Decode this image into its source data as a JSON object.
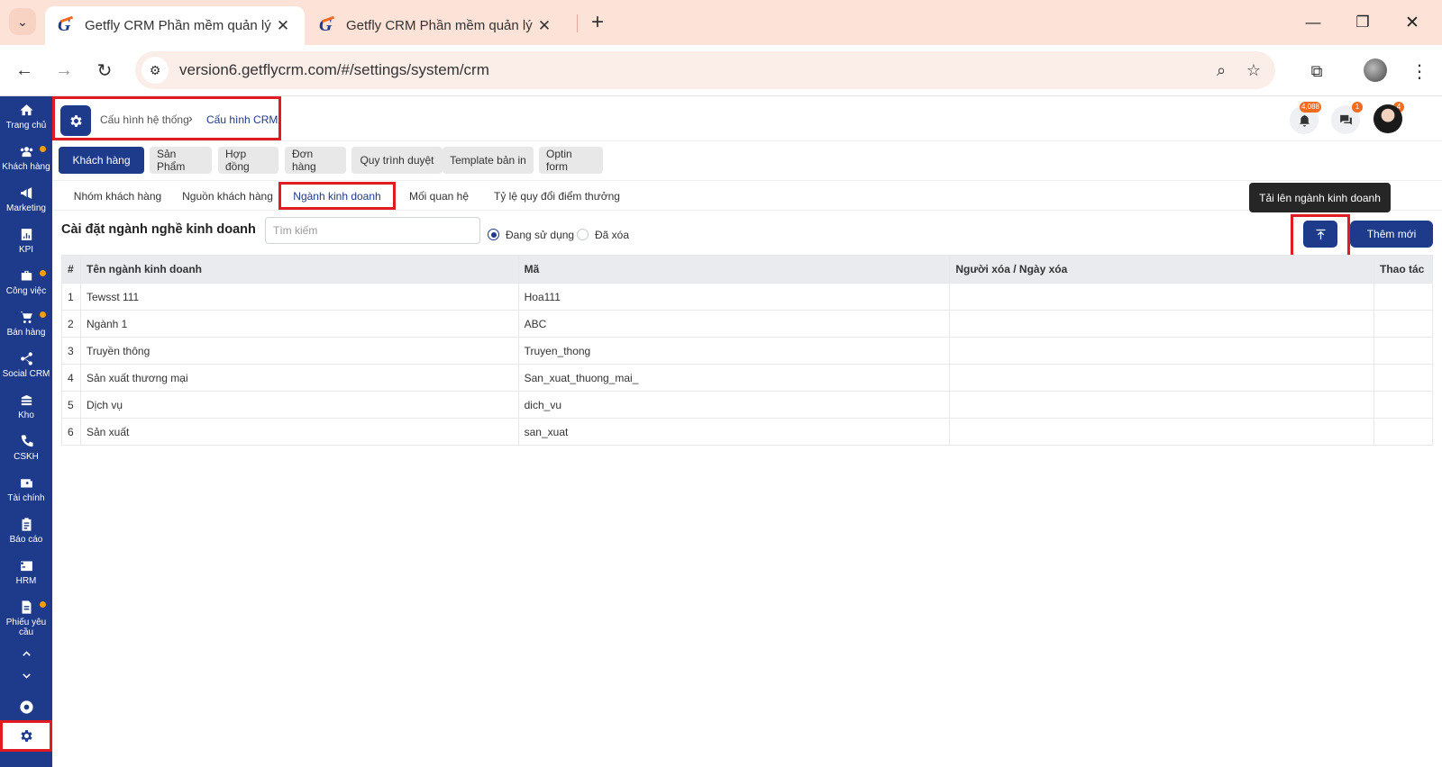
{
  "browser": {
    "tabs": [
      {
        "title": "Getfly CRM Phần mềm quản lý"
      },
      {
        "title": "Getfly CRM Phần mềm quản lý"
      }
    ],
    "url": "version6.getflycrm.com/#/settings/system/crm"
  },
  "sidebar": {
    "items": [
      {
        "label": "Trang chủ",
        "icon": "home-icon"
      },
      {
        "label": "Khách hàng",
        "icon": "users-icon"
      },
      {
        "label": "Marketing",
        "icon": "megaphone-icon"
      },
      {
        "label": "KPI",
        "icon": "chart-icon"
      },
      {
        "label": "Công việc",
        "icon": "briefcase-icon"
      },
      {
        "label": "Bán hàng",
        "icon": "cart-icon"
      },
      {
        "label": "Social CRM",
        "icon": "share-icon"
      },
      {
        "label": "Kho",
        "icon": "warehouse-icon"
      },
      {
        "label": "CSKH",
        "icon": "phone-icon"
      },
      {
        "label": "Tài chính",
        "icon": "wallet-icon"
      },
      {
        "label": "Báo cáo",
        "icon": "clipboard-icon"
      },
      {
        "label": "HRM",
        "icon": "id-card-icon"
      },
      {
        "label": "Phiếu yêu cầu",
        "icon": "document-icon"
      }
    ]
  },
  "header": {
    "breadcrumb": [
      "Cấu hình hệ thống",
      "Cấu hình CRM"
    ],
    "notifications": {
      "bell": "4,088",
      "chat": "1",
      "rocket": "4"
    }
  },
  "main_tabs": [
    "Khách hàng",
    "Sản Phẩm",
    "Hợp đồng",
    "Đơn hàng",
    "Quy trình duyệt",
    "Template bản in",
    "Optin form"
  ],
  "sub_tabs": [
    "Nhóm khách hàng",
    "Nguồn khách hàng",
    "Ngành kinh doanh",
    "Mối quan hệ",
    "Tỷ lệ quy đổi điểm thưởng"
  ],
  "page": {
    "title": "Cài đặt ngành nghề kinh doanh",
    "search_placeholder": "Tìm kiếm",
    "radio_active": "Đang sử dụng",
    "radio_deleted": "Đã xóa",
    "tooltip": "Tải lên ngành kinh doanh",
    "add_label": "Thêm mới"
  },
  "table": {
    "headers": [
      "#",
      "Tên ngành kinh doanh",
      "Mã",
      "Người xóa / Ngày xóa",
      "Thao tác"
    ],
    "rows": [
      [
        "1",
        "Tewsst 111",
        "Hoa111",
        "",
        ""
      ],
      [
        "2",
        "Ngành 1",
        "ABC",
        "",
        ""
      ],
      [
        "3",
        "Truyền thông",
        "Truyen_thong",
        "",
        ""
      ],
      [
        "4",
        "Sản xuất thương mại",
        "San_xuat_thuong_mai_",
        "",
        ""
      ],
      [
        "5",
        "Dịch vụ",
        "dich_vu",
        "",
        ""
      ],
      [
        "6",
        "Sản xuất",
        "san_xuat",
        "",
        ""
      ]
    ]
  },
  "colors": {
    "primary": "#1e3a8a",
    "highlight": "#e01b22",
    "badge": "#f26b21"
  }
}
